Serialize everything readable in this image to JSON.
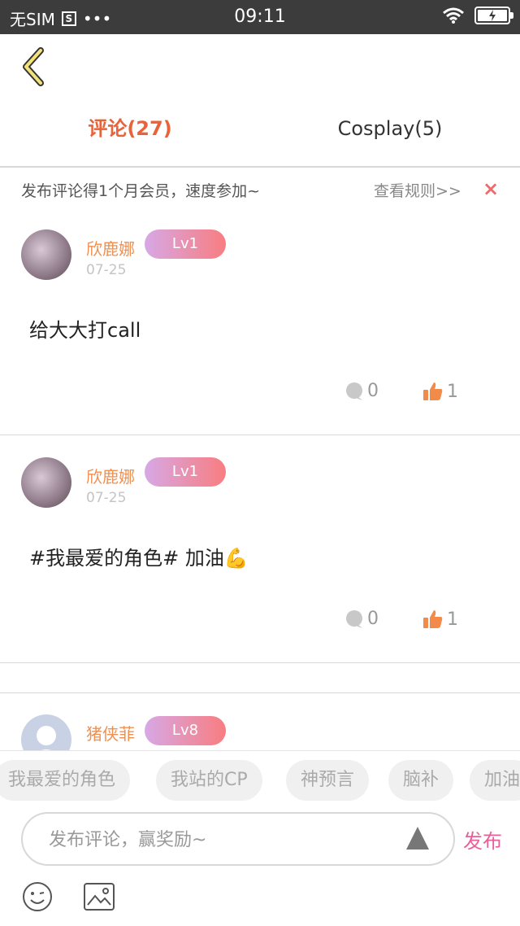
{
  "status_bar": {
    "carrier": "无SIM",
    "sim_icon": "S",
    "dots": "•••",
    "time": "09:11",
    "icons": [
      "wifi-icon",
      "battery-icon"
    ]
  },
  "nav": {
    "back_icon": "chevron-left-icon",
    "tabs": [
      {
        "label": "评论(27)",
        "active": true
      },
      {
        "label": "Cosplay(5)",
        "active": false
      }
    ]
  },
  "notice": {
    "text": "发布评论得1个月会员，速度参加~",
    "rules_link": "查看规则>>",
    "close": "×"
  },
  "comments": [
    {
      "username": "欣鹿娜",
      "level": "Lv1",
      "date": "07-25",
      "content": "给大大打call",
      "replies": "0",
      "likes": "1"
    },
    {
      "username": "欣鹿娜",
      "level": "Lv1",
      "date": "07-25",
      "content": "#我最爱的角色# 加油💪",
      "replies": "0",
      "likes": "1"
    },
    {
      "username": "猪侠菲",
      "level": "Lv8"
    }
  ],
  "chips": [
    "我最爱的角色",
    "我站的CP",
    "神预言",
    "脑补",
    "加油"
  ],
  "composer": {
    "placeholder": "发布评论，赢奖励~",
    "publish_label": "发布"
  },
  "colors": {
    "accent_orange": "#e8633a",
    "username": "#f09050",
    "publish_pink": "#e8609a",
    "level_gradient": [
      "#d7a8e6",
      "#f87d80"
    ]
  }
}
